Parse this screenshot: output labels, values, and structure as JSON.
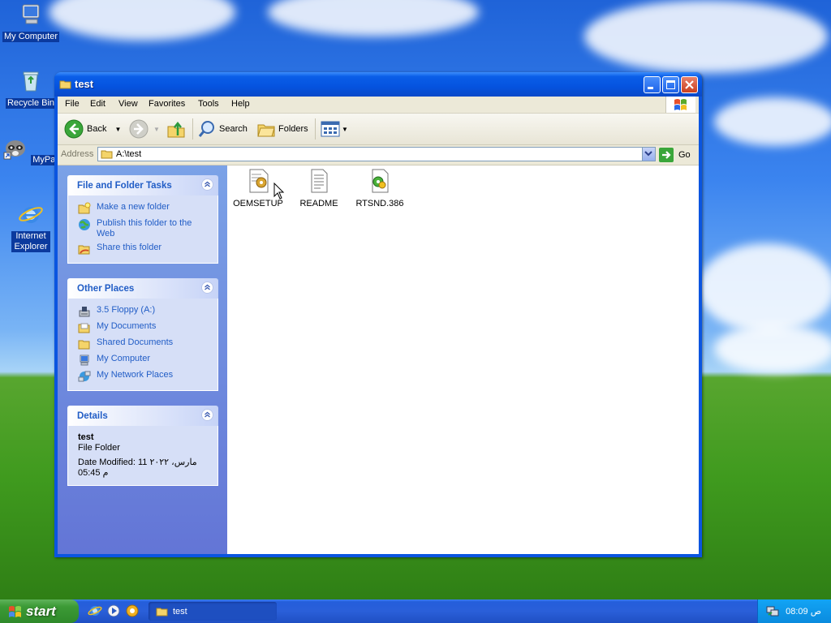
{
  "desktop": {
    "icons": [
      {
        "label": "My Computer"
      },
      {
        "label": "Recycle Bin"
      },
      {
        "label": "MyPal"
      },
      {
        "label": "Internet Explorer"
      }
    ]
  },
  "window": {
    "title": "test",
    "menu": [
      "File",
      "Edit",
      "View",
      "Favorites",
      "Tools",
      "Help"
    ],
    "toolbar": {
      "back": "Back",
      "search": "Search",
      "folders": "Folders"
    },
    "address": {
      "label": "Address",
      "value": "A:\\test",
      "go": "Go"
    },
    "file_tasks": {
      "title": "File and Folder Tasks",
      "items": [
        {
          "label": "Make a new folder",
          "icon": "new-folder-icon"
        },
        {
          "label": "Publish this folder to the Web",
          "icon": "globe-icon"
        },
        {
          "label": "Share this folder",
          "icon": "share-folder-icon"
        }
      ]
    },
    "other_places": {
      "title": "Other Places",
      "items": [
        {
          "label": "3.5 Floppy (A:)",
          "icon": "floppy-icon"
        },
        {
          "label": "My Documents",
          "icon": "folder-icon"
        },
        {
          "label": "Shared Documents",
          "icon": "folder-icon"
        },
        {
          "label": "My Computer",
          "icon": "computer-icon"
        },
        {
          "label": "My Network Places",
          "icon": "network-icon"
        }
      ]
    },
    "details": {
      "title": "Details",
      "name": "test",
      "type": "File Folder",
      "modified_line1": "Date Modified: 11 ۲۰۲۲ ،مارس",
      "modified_line2": "05:45 م"
    },
    "files": [
      {
        "name": "OEMSETUP"
      },
      {
        "name": "README"
      },
      {
        "name": "RTSND.386"
      }
    ]
  },
  "taskbar": {
    "start": "start",
    "task": "test",
    "clock": "08:09 ص"
  },
  "colors": {
    "link": "#215dc6",
    "titlebar": "#0553df",
    "taskbar": "#245edb"
  }
}
